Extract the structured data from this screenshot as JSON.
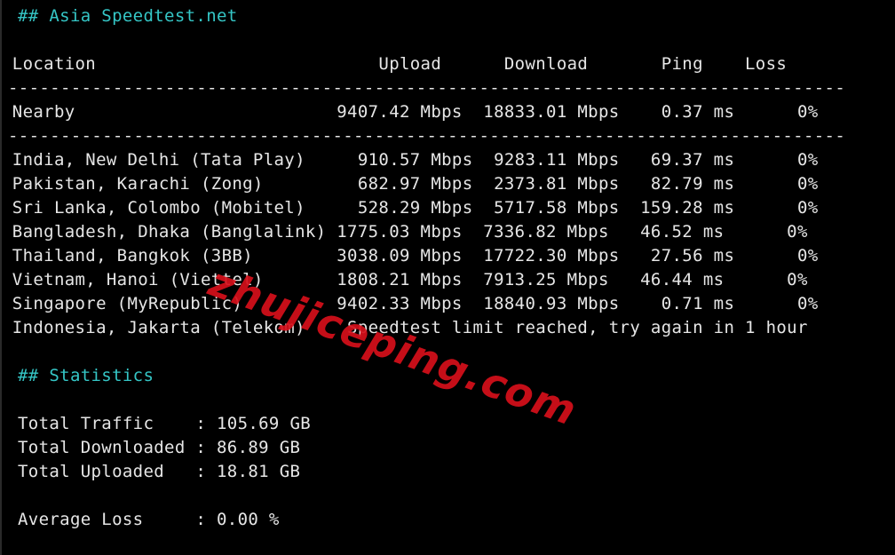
{
  "asia_heading": "## Asia Speedtest.net",
  "header_row": " Location                           Upload      Download       Ping    Loss",
  "divider": "--------------------------------------------------------------------------------",
  "nearby_row": " Nearby                         9407.42 Mbps  18833.01 Mbps    0.37 ms      0%",
  "rows": [
    " India, New Delhi (Tata Play)     910.57 Mbps  9283.11 Mbps   69.37 ms      0%",
    " Pakistan, Karachi (Zong)         682.97 Mbps  2373.81 Mbps   82.79 ms      0%",
    " Sri Lanka, Colombo (Mobitel)     528.29 Mbps  5717.58 Mbps  159.28 ms      0%",
    " Bangladesh, Dhaka (Banglalink) 1775.03 Mbps  7336.82 Mbps   46.52 ms      0%",
    " Thailand, Bangkok (3BB)        3038.09 Mbps  17722.30 Mbps   27.56 ms      0%",
    " Vietnam, Hanoi (Viettel)       1808.21 Mbps  7913.25 Mbps   46.44 ms      0%",
    " Singapore (MyRepublic)         9402.33 Mbps  18840.93 Mbps    0.71 ms      0%",
    " Indonesia, Jakarta (Telekom)    Speedtest limit reached, try again in 1 hour"
  ],
  "stats_heading": "## Statistics",
  "stats": [
    "Total Traffic    : 105.69 GB",
    "Total Downloaded : 86.89 GB",
    "Total Uploaded   : 18.81 GB"
  ],
  "average_loss": "Average Loss     : 0.00 %",
  "watermark": "zhujiceping.com",
  "colors": {
    "background": "#000000",
    "text": "#e6e6e6",
    "heading": "#35c6c6",
    "watermark": "#d6101b"
  }
}
